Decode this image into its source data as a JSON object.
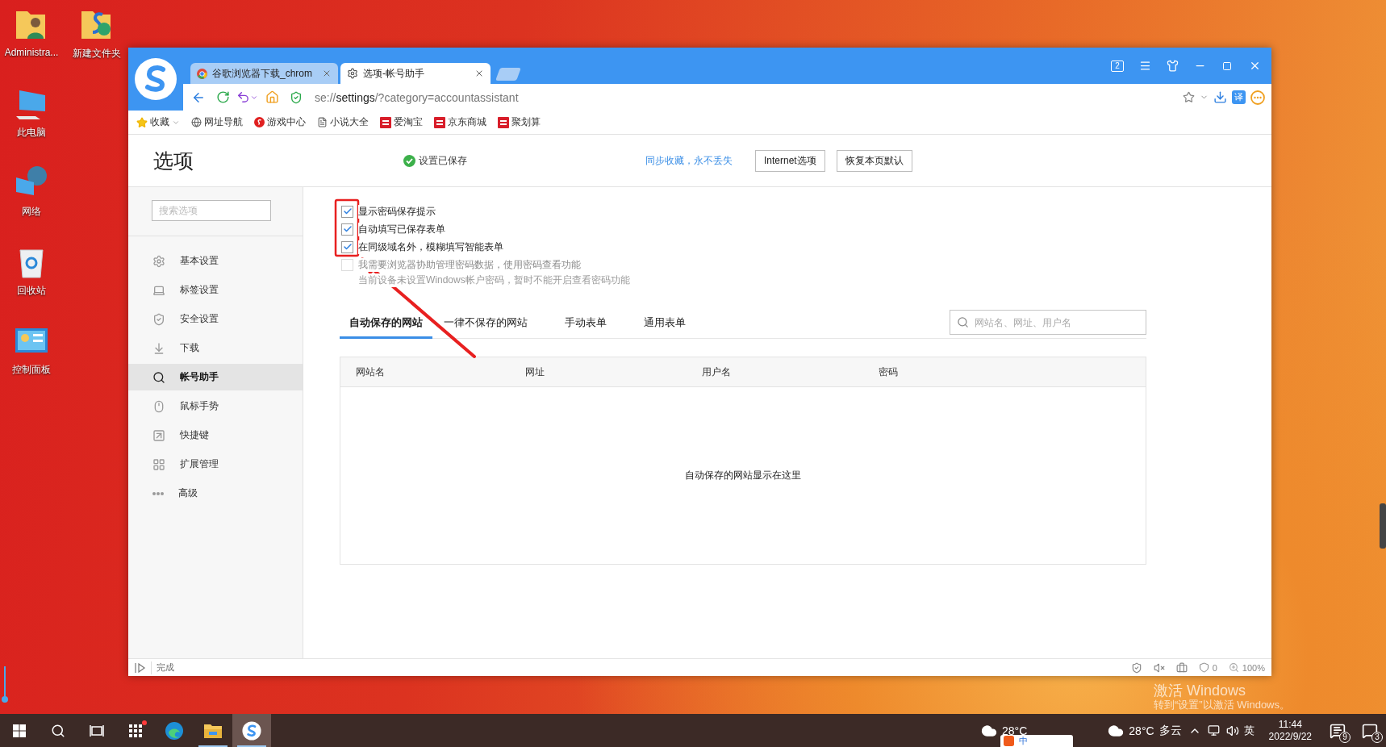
{
  "desktop": {
    "icon_columns": [
      {
        "icons": [
          {
            "label": "Administra...",
            "kind": "user-folder"
          },
          {
            "label": "此电脑",
            "kind": "computer"
          },
          {
            "label": "网络",
            "kind": "network"
          },
          {
            "label": "回收站",
            "kind": "recycle-bin"
          },
          {
            "label": "控制面板",
            "kind": "control-panel"
          }
        ]
      },
      {
        "icons": [
          {
            "label": "新建文件夹",
            "kind": "app-folder"
          }
        ]
      }
    ]
  },
  "browser": {
    "tabs": [
      {
        "title": "谷歌浏览器下载_chrom",
        "kind": "chrome",
        "selected": false
      },
      {
        "title": "选项-帐号助手",
        "kind": "settings",
        "selected": true
      }
    ],
    "window_badge": "2",
    "address": "se://**settings**/?category=accountassistant",
    "translate_label": "译",
    "bookmarks": [
      {
        "label": "收藏",
        "kind": "star"
      },
      {
        "label": "网址导航",
        "kind": "globe"
      },
      {
        "label": "游戏中心",
        "kind": "game"
      },
      {
        "label": "小说大全",
        "kind": "book"
      },
      {
        "label": "爱淘宝",
        "kind": "red-tag"
      },
      {
        "label": "京东商城",
        "kind": "red-tag"
      },
      {
        "label": "聚划算",
        "kind": "red-tag"
      }
    ]
  },
  "page": {
    "title": "选项",
    "saved_notice": "设置已保存",
    "sync_link": "同步收藏，永不丢失",
    "buttons": [
      "Internet选项",
      "恢复本页默认"
    ]
  },
  "sidebar": {
    "search_placeholder": "搜索选项",
    "items": [
      {
        "label": "基本设置",
        "kind": "gear",
        "selected": false
      },
      {
        "label": "标签设置",
        "kind": "tab",
        "selected": false
      },
      {
        "label": "安全设置",
        "kind": "shield",
        "selected": false
      },
      {
        "label": "下载",
        "kind": "download",
        "selected": false
      },
      {
        "label": "帐号助手",
        "kind": "key",
        "selected": true
      },
      {
        "label": "鼠标手势",
        "kind": "mouse",
        "selected": false
      },
      {
        "label": "快捷键",
        "kind": "shortcut",
        "selected": false
      },
      {
        "label": "扩展管理",
        "kind": "grid",
        "selected": false
      },
      {
        "label": "高级",
        "kind": "more",
        "selected": false
      }
    ]
  },
  "options": [
    {
      "label": "显示密码保存提示",
      "checked": true,
      "disabled": false
    },
    {
      "label": "自动填写已保存表单",
      "checked": true,
      "disabled": false
    },
    {
      "label": "在同级域名外，模糊填写智能表单",
      "checked": true,
      "disabled": false
    },
    {
      "label": "我需要浏览器协助管理密码数据，使用密码查看功能",
      "checked": false,
      "disabled": true,
      "note": "当前设备未设置Windows帐户密码，暂时不能开启查看密码功能"
    }
  ],
  "password_tabs": [
    {
      "label": "自动保存的网站",
      "selected": true
    },
    {
      "label": "一律不保存的网站",
      "selected": false
    },
    {
      "label": "手动表单",
      "selected": false
    },
    {
      "label": "通用表单",
      "selected": false
    }
  ],
  "site_search_placeholder": "网站名、网址、用户名",
  "table": {
    "columns": [
      "网站名",
      "网址",
      "用户名",
      "密码"
    ],
    "empty_message": "自动保存的网站显示在这里"
  },
  "status_bar": {
    "text": "完成",
    "ad_count": "0",
    "zoom": "100%"
  },
  "watermark": {
    "title": "激活 Windows",
    "hint": "转到“设置”以激活 Windows。"
  },
  "taskbar": {
    "apps": [
      {
        "kind": "start",
        "running": false,
        "selected": false
      },
      {
        "kind": "search",
        "running": false,
        "selected": false
      },
      {
        "kind": "task-view",
        "running": false,
        "selected": false
      },
      {
        "kind": "apps",
        "running": false,
        "selected": false
      },
      {
        "kind": "edge",
        "running": false,
        "selected": false
      },
      {
        "kind": "explorer",
        "running": true,
        "selected": false
      },
      {
        "kind": "browser",
        "running": true,
        "selected": true
      }
    ],
    "weather": [
      {
        "temp": "28°C"
      },
      {
        "temp": "28°C",
        "condition": "多云"
      }
    ],
    "ime_bar": "中",
    "input_mode": "英",
    "time": "11:44",
    "date": "2022/9/22",
    "notification_count": "9",
    "action_count": "3"
  }
}
